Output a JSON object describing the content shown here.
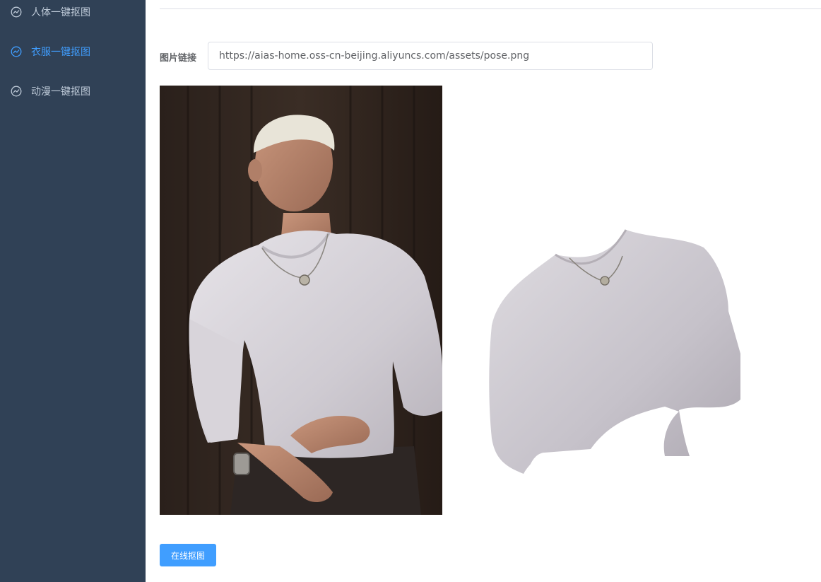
{
  "sidebar": {
    "items": [
      {
        "label": "人体一键抠图",
        "icon": "chart-icon",
        "active": false
      },
      {
        "label": "衣服一键抠图",
        "icon": "chart-icon",
        "active": true
      },
      {
        "label": "动漫一键抠图",
        "icon": "chart-icon",
        "active": false
      }
    ]
  },
  "form": {
    "url_label": "图片链接",
    "url_value": "https://aias-home.oss-cn-beijing.aliyuncs.com/assets/pose.png"
  },
  "images": {
    "original": "photo of a man with bleached short hair wearing a white long-sleeve shirt and a pendant necklace",
    "result": "segmented white long-sleeve shirt with necklace on transparent background"
  },
  "actions": {
    "submit_label": "在线抠图"
  },
  "colors": {
    "sidebar_bg": "#304156",
    "sidebar_text": "#bfcbd9",
    "active": "#409eff",
    "primary_button": "#409eff"
  }
}
